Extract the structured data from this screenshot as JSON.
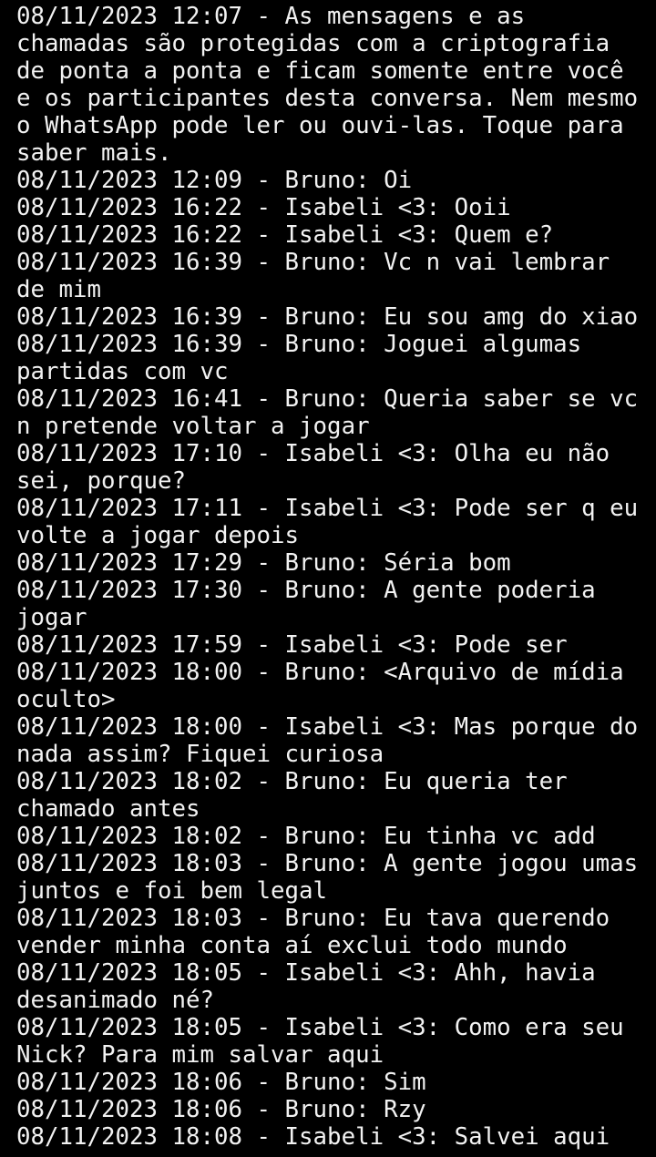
{
  "colors": {
    "background": "#000000",
    "text": "#f2f2f2"
  },
  "entries": [
    "08/11/2023 12:07 - As mensagens e as chamadas são protegidas com a criptografia de ponta a ponta e ficam somente entre você e os participantes desta conversa. Nem mesmo o WhatsApp pode ler ou ouvi-las. Toque para saber mais.",
    "08/11/2023 12:09 - Bruno: Oi",
    "08/11/2023 16:22 - Isabeli <3: Ooii",
    "08/11/2023 16:22 - Isabeli <3: Quem e?",
    "08/11/2023 16:39 - Bruno: Vc n vai lembrar de mim",
    "08/11/2023 16:39 - Bruno: Eu sou amg do xiao",
    "08/11/2023 16:39 - Bruno: Joguei algumas partidas com vc",
    "08/11/2023 16:41 - Bruno: Queria saber se vc n pretende voltar a jogar",
    "08/11/2023 17:10 - Isabeli <3: Olha eu não sei, porque?",
    "08/11/2023 17:11 - Isabeli <3: Pode ser q eu volte a jogar depois",
    "08/11/2023 17:29 - Bruno: Séria bom",
    "08/11/2023 17:30 - Bruno: A gente poderia jogar",
    "08/11/2023 17:59 - Isabeli <3: Pode ser",
    "08/11/2023 18:00 - Bruno: <Arquivo de mídia oculto>",
    "08/11/2023 18:00 - Isabeli <3: Mas porque do nada assim? Fiquei curiosa",
    "08/11/2023 18:02 - Bruno: Eu queria ter chamado antes",
    "08/11/2023 18:02 - Bruno: Eu tinha vc add",
    "08/11/2023 18:03 - Bruno: A gente jogou umas juntos e foi bem legal",
    "08/11/2023 18:03 - Bruno: Eu tava querendo vender minha conta aí exclui todo mundo",
    "08/11/2023 18:05 - Isabeli <3: Ahh, havia desanimado né?",
    "08/11/2023 18:05 - Isabeli <3: Como era seu Nick? Para mim salvar aqui",
    "08/11/2023 18:06 - Bruno: Sim",
    "08/11/2023 18:06 - Bruno: Rzy",
    "08/11/2023 18:08 - Isabeli <3: Salvei aqui"
  ]
}
